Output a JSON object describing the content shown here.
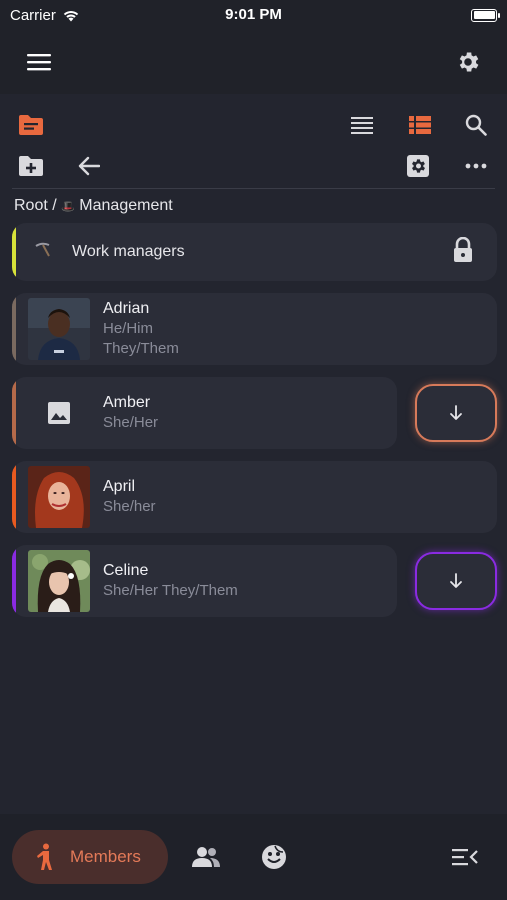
{
  "status_bar": {
    "carrier": "Carrier",
    "time": "9:01 PM"
  },
  "breadcrumb": {
    "root": "Root",
    "separator": " / ",
    "folder_emoji": "🎩",
    "current": "Management"
  },
  "folder": {
    "label": "Work managers",
    "stripe_color": "#d7e23a",
    "icon": "pickaxe-icon",
    "lock_icon": "lock-icon"
  },
  "members": [
    {
      "name": "Adrian",
      "pronouns": [
        "He/Him",
        "They/Them"
      ],
      "stripe_color": "#7a6a60",
      "has_download": false
    },
    {
      "name": "Amber",
      "pronouns": [
        "She/Her"
      ],
      "stripe_color": "#b56a4a",
      "has_download": true,
      "download_color": "#d77a5a"
    },
    {
      "name": "April",
      "pronouns": [
        "She/her"
      ],
      "stripe_color": "#e85a20",
      "has_download": false
    },
    {
      "name": "Celine",
      "pronouns": [
        "She/Her They/Them"
      ],
      "stripe_color": "#8a2be2",
      "has_download": true,
      "download_color": "#8a2be2"
    }
  ],
  "bottom_nav": {
    "active_label": "Members"
  },
  "colors": {
    "accent": "#e8693f",
    "background": "#23252f",
    "card": "#2b2d38"
  }
}
